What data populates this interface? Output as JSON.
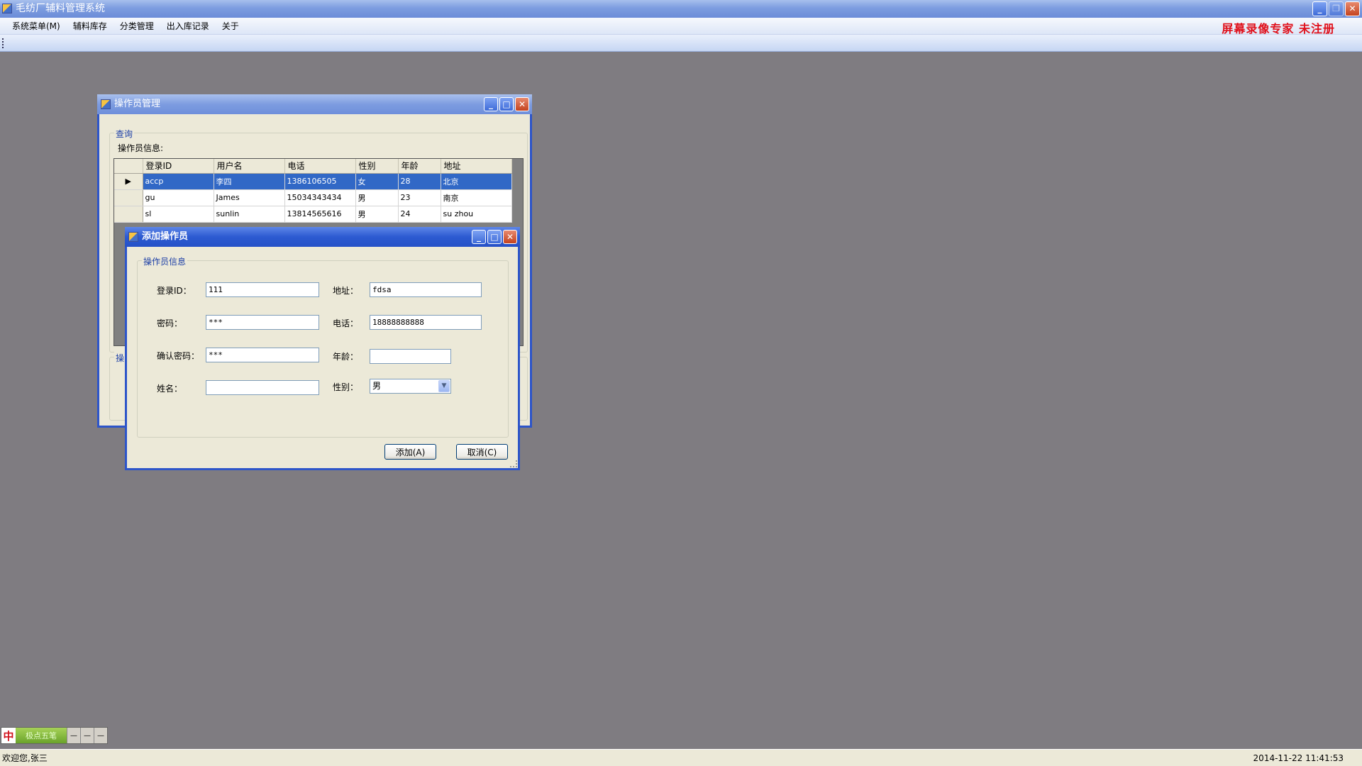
{
  "app": {
    "title": "毛纺厂辅料管理系统",
    "watermark": "屏幕录像专家  未注册"
  },
  "menubar": {
    "items": [
      "系统菜单(M)",
      "辅料库存",
      "分类管理",
      "出入库记录",
      "关于"
    ]
  },
  "operator_window": {
    "title": "操作员管理",
    "group_query": "查询",
    "info_label": "操作员信息:",
    "group_ops_partial": "操",
    "columns": [
      "登录ID",
      "用户名",
      "电话",
      "性别",
      "年龄",
      "地址"
    ],
    "rows": [
      {
        "id": "accp",
        "name": "李四",
        "phone": "1386106505",
        "gender": "女",
        "age": "28",
        "address": "北京"
      },
      {
        "id": "gu",
        "name": "James",
        "phone": "15034343434",
        "gender": "男",
        "age": "23",
        "address": "南京"
      },
      {
        "id": "sl",
        "name": "sunlin",
        "phone": "13814565616",
        "gender": "男",
        "age": "24",
        "address": "su zhou"
      }
    ],
    "selected_row_indicator": "▶"
  },
  "add_dialog": {
    "title": "添加操作员",
    "group": "操作员信息",
    "labels": {
      "login_id": "登录ID：",
      "password": "密码：",
      "confirm_password": "确认密码：",
      "name": "姓名：",
      "address": "地址：",
      "phone": "电话：",
      "age": "年龄：",
      "gender": "性别："
    },
    "values": {
      "login_id": "111",
      "password": "***",
      "confirm_password": "***",
      "name": "",
      "address": "fdsa",
      "phone": "18888888888",
      "age": "",
      "gender": "男"
    },
    "buttons": {
      "add": "添加(A)",
      "cancel": "取消(C)"
    }
  },
  "ime": {
    "logo": "中",
    "mode": "极点五笔"
  },
  "status": {
    "welcome": "欢迎您,张三",
    "datetime": "2014-11-22 11:41:53"
  },
  "colors": {
    "titlebar_active": "#2c5ad1",
    "selection": "#3168c6",
    "watermark": "#e0101b",
    "mdi_background": "#7f7c81"
  }
}
